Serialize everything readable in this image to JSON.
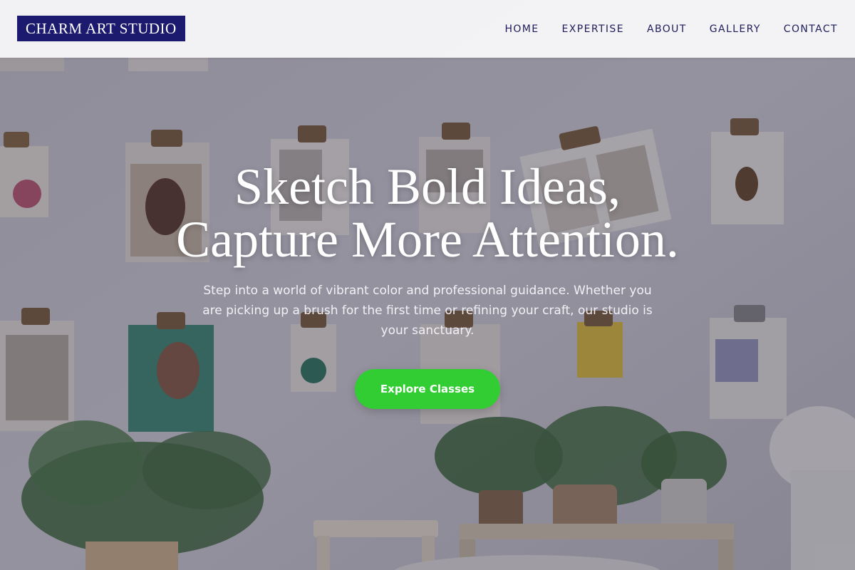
{
  "header": {
    "logo": "CHARM ART STUDIO",
    "nav": [
      {
        "label": "HOME"
      },
      {
        "label": "EXPERTISE"
      },
      {
        "label": "ABOUT"
      },
      {
        "label": "GALLERY"
      },
      {
        "label": "CONTACT"
      }
    ]
  },
  "hero": {
    "title_line1": "Sketch Bold Ideas,",
    "title_line2": "Capture More Attention.",
    "subtitle": "Step into a world of vibrant color and professional guidance. Whether you are picking up a brush for the first time or refining your craft, our studio is your sanctuary.",
    "cta_label": "Explore Classes"
  },
  "colors": {
    "brand_navy": "#1c1a6e",
    "cta_green": "#32cd32",
    "nav_text": "#1e1d5a"
  }
}
